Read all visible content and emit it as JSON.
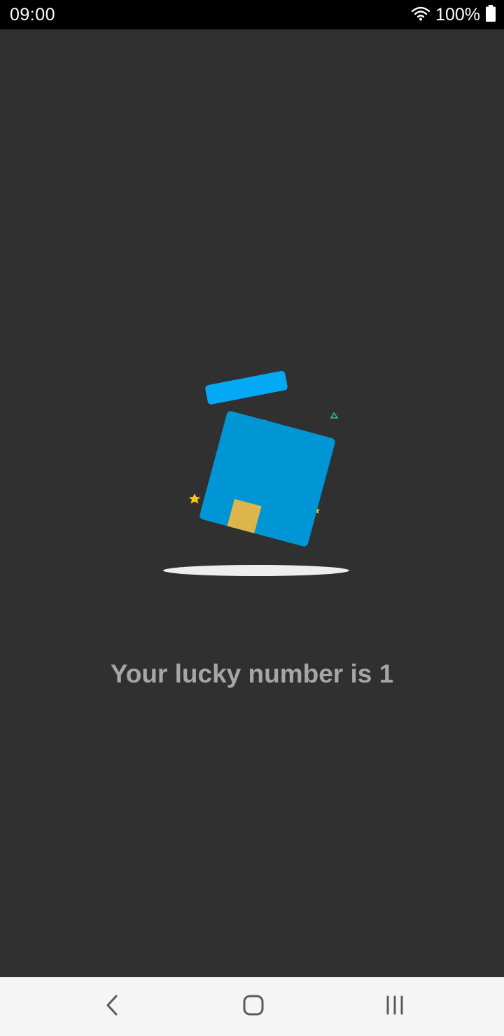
{
  "status_bar": {
    "time": "09:00",
    "battery_text": "100%",
    "icons": [
      "wifi-icon",
      "battery-icon"
    ]
  },
  "main": {
    "message": "Your lucky number is 1"
  },
  "nav_bar": {
    "icons": [
      "back-icon",
      "home-icon",
      "recents-icon"
    ]
  },
  "colors": {
    "background": "#303030",
    "gift_box": "#0096d6",
    "gift_lid": "#03a9f4",
    "ribbon": "#ddb54a",
    "star": "#f5c518",
    "shadow": "#eeeeee",
    "message_text": "#a6a6a6"
  }
}
